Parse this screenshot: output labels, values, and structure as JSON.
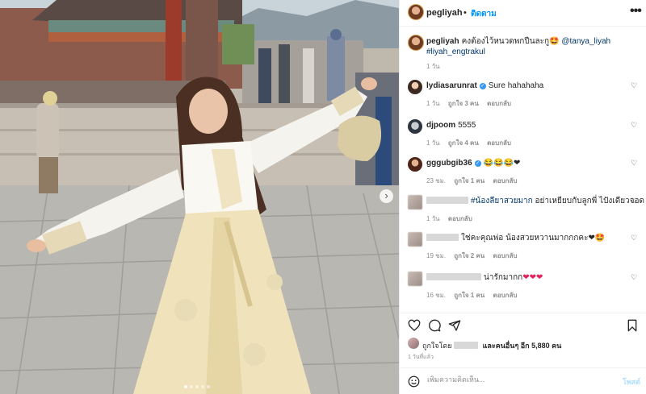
{
  "header": {
    "username": "pegliyah",
    "separator": "•",
    "follow_label": "ติดตาม",
    "more_icon": "more-horizontal-icon"
  },
  "caption": {
    "username": "pegliyah",
    "text": "คงต้องไว้หนวดพกปืนละกู🤩",
    "mention": "@tanya_liyah",
    "hashtag": "#liyah_engtrakul",
    "time": "1 วัน"
  },
  "comments": [
    {
      "username": "lydiasarunrat",
      "verified": true,
      "text": "Sure hahahaha",
      "time": "1 วัน",
      "likes": "ถูกใจ 3 คน",
      "reply": "ตอบกลับ"
    },
    {
      "username": "djpoom",
      "verified": false,
      "text": "5555",
      "time": "1 วัน",
      "likes": "ถูกใจ 4 คน",
      "reply": "ตอบกลับ"
    },
    {
      "username": "gggubgib36",
      "verified": true,
      "text": "😂😂😂❤",
      "time": "23 ชม.",
      "likes": "ถูกใจ 1 คน",
      "reply": "ตอบกลับ"
    },
    {
      "username": "",
      "hashtag": "#น้องลียาสวยมาก",
      "text": "อย่าเหยียบกับลูกพี่ ไปังเดียวจอด",
      "time": "1 วัน",
      "reply": "ตอบกลับ"
    },
    {
      "username": "",
      "text": "ใช่คะคุณพ่อ น้องสวยหวานมากกกคะ❤🤩",
      "time": "19 ชม.",
      "likes": "ถูกใจ 2 คน",
      "reply": "ตอบกลับ"
    },
    {
      "username": "",
      "text": "น่ารักมากก",
      "hearts": "❤❤❤",
      "time": "16 ชม.",
      "likes": "ถูกใจ 1 คน",
      "reply": "ตอบกลับ"
    }
  ],
  "actions": {
    "like_icon": "heart-outline-icon",
    "comment_icon": "comment-icon",
    "share_icon": "share-icon",
    "save_icon": "bookmark-icon"
  },
  "likes": {
    "prefix": "ถูกใจโดย",
    "and_others": "และคนอื่นๆ อีก 5,880 คน"
  },
  "post_time": "1 วันที่แล้ว",
  "add_comment": {
    "placeholder": "เพิ่มความคิดเห็น...",
    "post_label": "โพสต์",
    "emoji_icon": "emoji-smile-icon"
  },
  "carousel": {
    "slide_count": 5,
    "active_index": 0,
    "next_icon": "chevron-right-icon"
  },
  "colors": {
    "accent": "#0095f6",
    "link": "#00376b",
    "muted": "#8e8e8e",
    "heart": "#e0245e",
    "verified": "#3897f0",
    "post_disabled": "#b2dffc"
  }
}
